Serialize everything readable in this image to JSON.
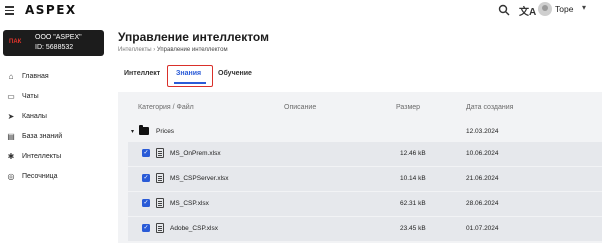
{
  "topbar": {
    "logo": "ASPEX",
    "translate_glyph": "文A",
    "user_name": "Tope",
    "chevron": "▾"
  },
  "org": {
    "logo_text": "ПАК",
    "name": "ООО \"ASPEX\"",
    "id": "ID: 5688532"
  },
  "sidebar": {
    "items": [
      {
        "label": "Главная",
        "icon": "home-icon",
        "glyph": "⌂"
      },
      {
        "label": "Чаты",
        "icon": "chat-icon",
        "glyph": "▭"
      },
      {
        "label": "Каналы",
        "icon": "channels-icon",
        "glyph": "➤"
      },
      {
        "label": "База знаний",
        "icon": "knowledge-base-icon",
        "glyph": "▤"
      },
      {
        "label": "Интеллекты",
        "icon": "intellects-icon",
        "glyph": "✱"
      },
      {
        "label": "Песочница",
        "icon": "sandbox-icon",
        "glyph": "◎"
      }
    ]
  },
  "page": {
    "title": "Управление интеллектом",
    "breadcrumb_root": "Интеллекты",
    "breadcrumb_sep": "›",
    "breadcrumb_current": "Управление интеллектом"
  },
  "tabs": [
    {
      "label": "Интеллект",
      "active": false
    },
    {
      "label": "Знания",
      "active": true
    },
    {
      "label": "Обучение",
      "active": false
    }
  ],
  "table": {
    "columns": [
      "Категория / Файл",
      "Описание",
      "Размер",
      "Дата создания"
    ],
    "folder": {
      "caret": "▾",
      "name": "Prices",
      "date": "12.03.2024"
    },
    "rows": [
      {
        "name": "MS_OnPrem.xlsx",
        "size": "12.46 kB",
        "date": "10.06.2024"
      },
      {
        "name": "MS_CSPServer.xlsx",
        "size": "10.14 kB",
        "date": "21.06.2024"
      },
      {
        "name": "MS_CSP.xlsx",
        "size": "62.31 kB",
        "date": "28.06.2024"
      },
      {
        "name": "Adobe_CSP.xlsx",
        "size": "23.45 kB",
        "date": "01.07.2024"
      }
    ]
  },
  "colors": {
    "accent": "#2a5bd7",
    "highlight": "#d9302a",
    "org_card": "#1c1c1c"
  }
}
